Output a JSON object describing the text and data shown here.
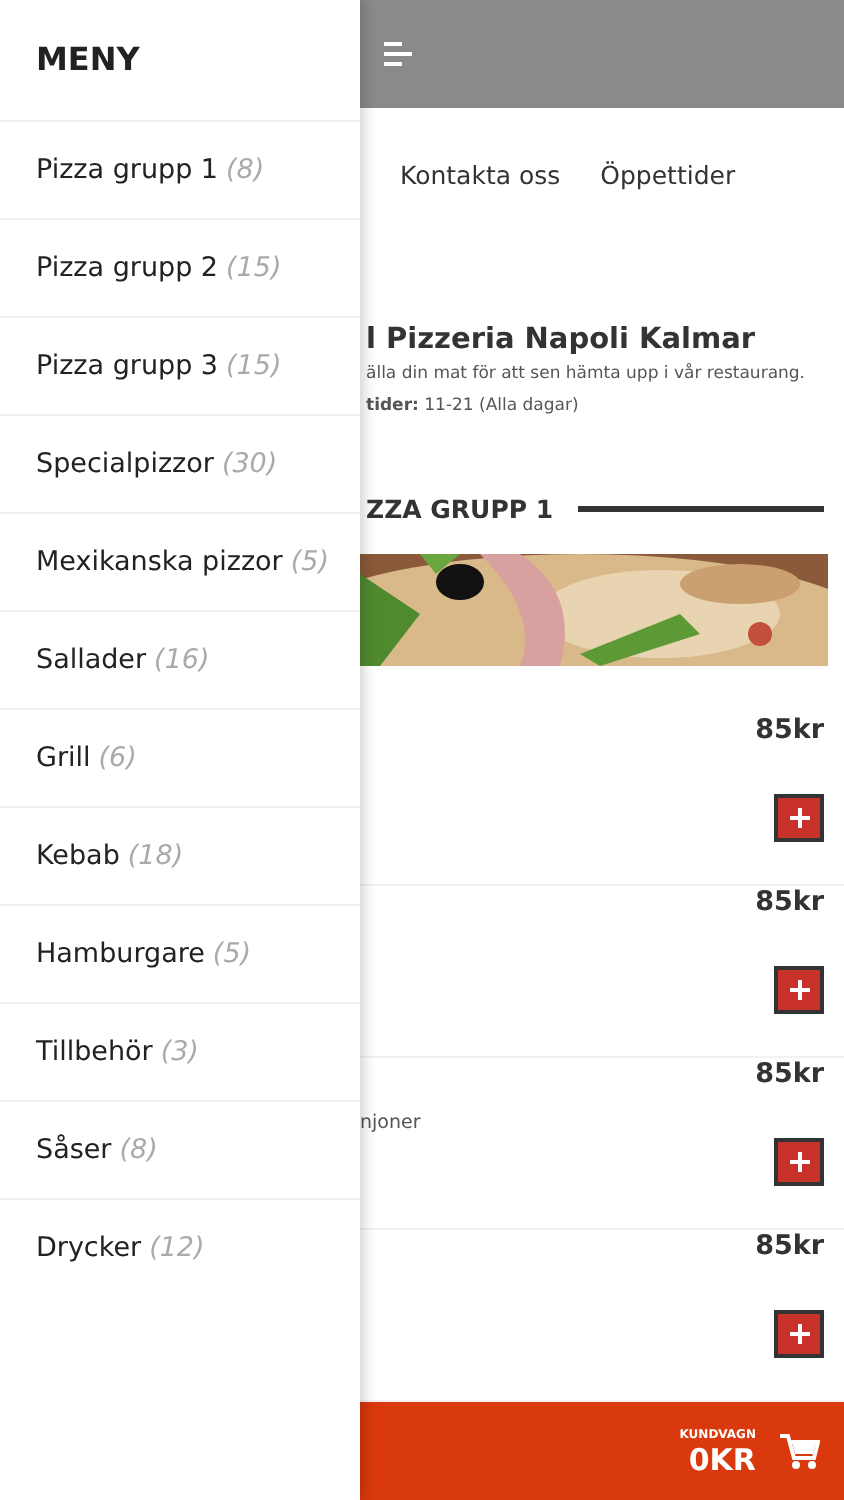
{
  "drawer": {
    "title": "MENY",
    "categories": [
      {
        "name": "Pizza grupp 1",
        "count": "(8)"
      },
      {
        "name": "Pizza grupp 2",
        "count": "(15)"
      },
      {
        "name": "Pizza grupp 3",
        "count": "(15)"
      },
      {
        "name": "Specialpizzor",
        "count": "(30)"
      },
      {
        "name": "Mexikanska pizzor",
        "count": "(5)"
      },
      {
        "name": "Sallader",
        "count": "(16)"
      },
      {
        "name": "Grill",
        "count": "(6)"
      },
      {
        "name": "Kebab",
        "count": "(18)"
      },
      {
        "name": "Hamburgare",
        "count": "(5)"
      },
      {
        "name": "Tillbehör",
        "count": "(3)"
      },
      {
        "name": "Såser",
        "count": "(8)"
      },
      {
        "name": "Drycker",
        "count": "(12)"
      }
    ]
  },
  "nav": [
    "Kontakta oss",
    "Öppettider"
  ],
  "restaurant": {
    "title": "l Pizzeria Napoli Kalmar",
    "description": "älla din mat för att sen hämta upp i vår restaurang.",
    "hours": "**tider:** 11-21 (Alla dagar)"
  },
  "section": {
    "heading": "ZZA GRUPP 1"
  },
  "products": [
    {
      "price": "85kr"
    },
    {
      "price": "85kr"
    },
    {
      "price": "85kr",
      "description": "njoner"
    },
    {
      "price": "85kr"
    }
  ],
  "cart": {
    "label": "KUNDVAGN",
    "total": "0KR"
  }
}
